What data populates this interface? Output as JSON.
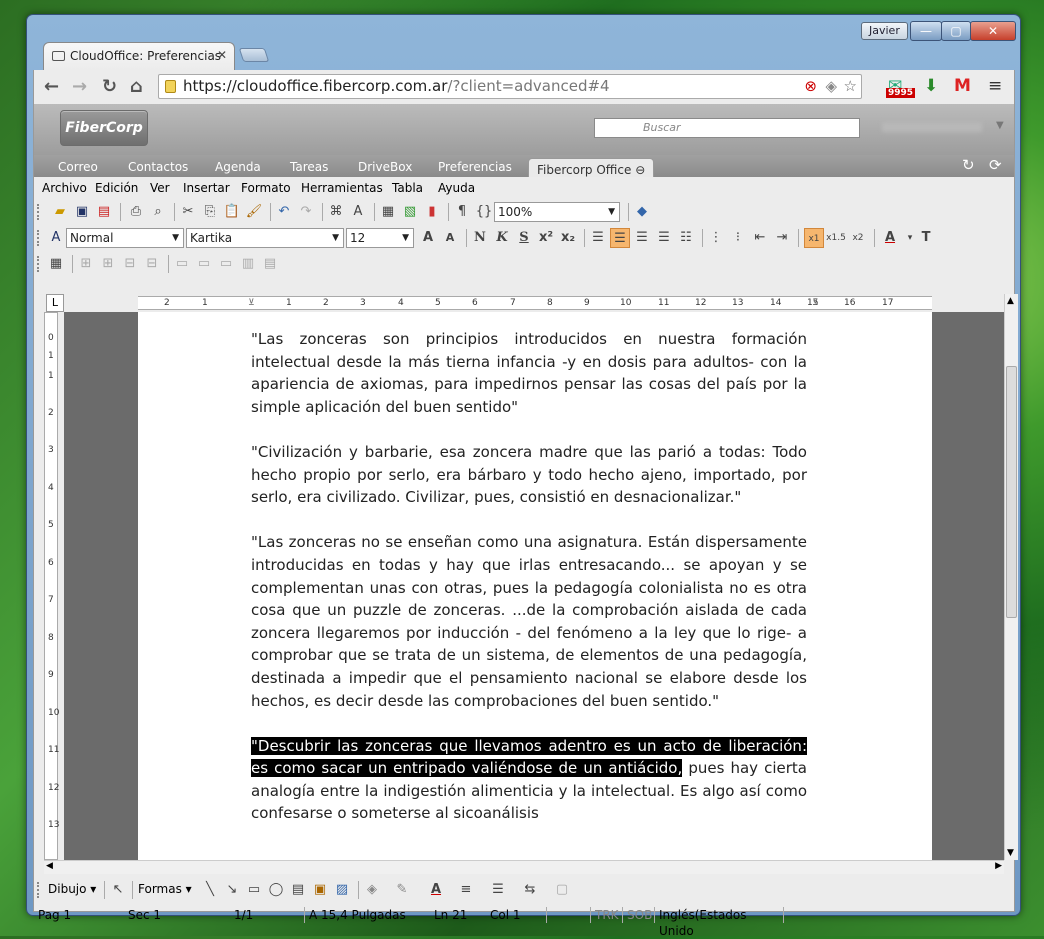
{
  "window": {
    "user": "Javier",
    "minimize": "—",
    "maximize": "▢",
    "close": "✕"
  },
  "browser": {
    "tab_title": "CloudOffice: Preferencias",
    "tab_close": "✕",
    "url_host": "https://cloudoffice.fibercorp.com.ar",
    "url_path": "/?client=advanced#4",
    "badge": "9995"
  },
  "app": {
    "logo": "FiberCorp",
    "search_placeholder": "Buscar",
    "nav": [
      "Correo",
      "Contactos",
      "Agenda",
      "Tareas",
      "DriveBox",
      "Preferencias"
    ],
    "active_tab": "Fibercorp Office"
  },
  "menu": [
    "Archivo",
    "Edición",
    "Ver",
    "Insertar",
    "Formato",
    "Herramientas",
    "Tabla",
    "Ayuda"
  ],
  "format": {
    "zoom": "100%",
    "style": "Normal",
    "font": "Kartika",
    "size": "12",
    "bold": "N",
    "italic": "K",
    "underline": "S"
  },
  "ruler": [
    "2",
    "1",
    "1",
    "2",
    "3",
    "4",
    "5",
    "6",
    "7",
    "8",
    "9",
    "10",
    "11",
    "12",
    "13",
    "14",
    "15",
    "16",
    "17"
  ],
  "vruler": [
    "0",
    "1",
    "1",
    "2",
    "3",
    "4",
    "5",
    "6",
    "7",
    "8",
    "9",
    "10",
    "11",
    "12",
    "13"
  ],
  "document": {
    "p1": "\"Las zonceras son principios introducidos en nuestra formación intelectual desde la más tierna infancia -y en dosis para adultos- con la apariencia de axiomas, para impedirnos pensar las cosas del país por la simple aplicación del buen sentido\"",
    "p2": "\"Civilización y barbarie, esa zoncera madre que las parió a todas: Todo hecho propio por serlo, era bárbaro y todo hecho ajeno, importado, por serlo, era civilizado. Civilizar, pues, consistió en desnacionalizar.\"",
    "p3": "\"Las zonceras no se enseñan como una asignatura. Están dispersamente introducidas en todas y hay que irlas entresacando... se apoyan y se complementan unas con otras, pues la pedagogía colonialista no es otra cosa que un puzzle de zonceras. ...de la comprobación aislada de cada zoncera llegaremos por inducción - del fenómeno a la ley que lo rige- a comprobar que se trata de un sistema, de elementos de una pedagogía, destinada a impedir que el pensamiento nacional se elabore desde los hechos, es decir desde las comprobaciones del buen sentido.\"",
    "p4_sel": "\"Descubrir las zonceras que llevamos adentro es un acto de liberación: es como sacar un entripado valiéndose de un antiácido,",
    "p4_rest": " pues hay cierta analogía entre la indigestión alimenticia y la intelectual. Es algo así como confesarse o someterse al sicoanálisis"
  },
  "drawbar": {
    "draw": "Dibujo",
    "shapes": "Formas"
  },
  "status": {
    "page": "Pag 1",
    "section": "Sec 1",
    "count": "1/1",
    "position": "A 15,4 Pulgadas",
    "line": "Ln 21",
    "col": "Col 1",
    "trk": "TRK",
    "sob": "SOB",
    "lang": "Inglés(Estados Unido"
  }
}
